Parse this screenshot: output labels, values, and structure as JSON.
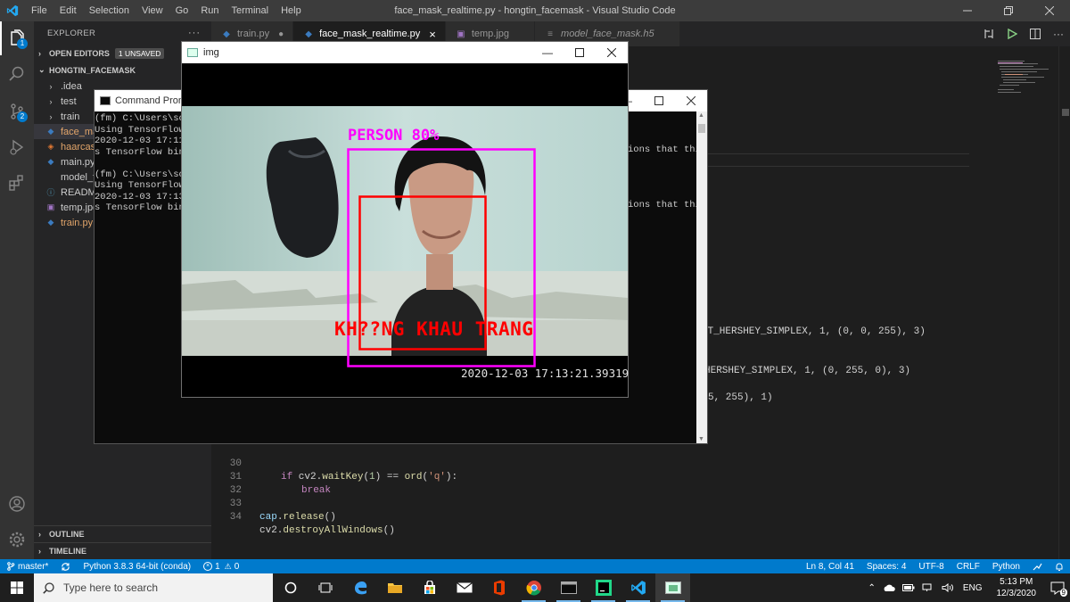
{
  "vscode": {
    "menu": [
      "File",
      "Edit",
      "Selection",
      "View",
      "Go",
      "Run",
      "Terminal",
      "Help"
    ],
    "title": "face_mask_realtime.py - hongtin_facemask - Visual Studio Code",
    "explorer_label": "EXPLORER",
    "open_editors_label": "OPEN EDITORS",
    "unsaved_badge": "1 UNSAVED",
    "project_label": "HONGTIN_FACEMASK",
    "tree": [
      {
        "name": ".idea",
        "kind": "folder",
        "color": "#cccccc"
      },
      {
        "name": "test",
        "kind": "folder",
        "color": "#cccccc"
      },
      {
        "name": "train",
        "kind": "folder",
        "color": "#cccccc"
      },
      {
        "name": "face_mask_realtime.py",
        "kind": "file",
        "color": "#e2a56a"
      },
      {
        "name": "haarcascade_frontalface_default.xml",
        "kind": "file",
        "color": "#e2a56a"
      },
      {
        "name": "main.py",
        "kind": "file",
        "color": "#cccccc"
      },
      {
        "name": "model_face_mask.h5",
        "kind": "file",
        "color": "#cccccc"
      },
      {
        "name": "README.md",
        "kind": "file",
        "color": "#cccccc"
      },
      {
        "name": "temp.jpg",
        "kind": "file",
        "color": "#cccccc"
      },
      {
        "name": "train.py",
        "kind": "file",
        "color": "#e2a56a"
      }
    ],
    "outline_label": "OUTLINE",
    "timeline_label": "TIMELINE",
    "tabs": [
      {
        "label": "train.py",
        "modified": true,
        "active": false,
        "italic": false
      },
      {
        "label": "face_mask_realtime.py",
        "modified": false,
        "active": true,
        "italic": false
      },
      {
        "label": "temp.jpg",
        "modified": false,
        "active": false,
        "italic": false
      },
      {
        "label": "model_face_mask.h5",
        "modified": false,
        "active": false,
        "italic": true
      }
    ],
    "activity_badges": {
      "explorer": "1",
      "scm": "2"
    },
    "code_fragments": {
      "line_a": "NT_HERSHEY_SIMPLEX, 1, (0, 0, 255), 3)",
      "line_b": "HERSHEY_SIMPLEX, 1, (0, 255, 0), 3)",
      "line_c": "5, 255), 1)"
    },
    "code_lines": [
      {
        "num": "30",
        "text": "if cv2.waitKey(1) == ord('q'):"
      },
      {
        "num": "31",
        "text": "break"
      },
      {
        "num": "32",
        "text": ""
      },
      {
        "num": "33",
        "text": "cap.release()"
      },
      {
        "num": "34",
        "text": "cv2.destroyAllWindows()"
      }
    ],
    "statusbar": {
      "branch": "master*",
      "python": "Python 3.8.3 64-bit (conda)",
      "errors": "1",
      "warnings": "0",
      "position": "Ln 8, Col 41",
      "spaces": "Spaces: 4",
      "encoding": "UTF-8",
      "eol": "CRLF",
      "language": "Python"
    }
  },
  "cmd": {
    "title": "Command Prompt",
    "lines": [
      "(fm) C:\\Users\\sonn",
      "Using TensorFlow b",
      "2020-12-03 17:11:4",
      "s TensorFlow binar",
      "",
      "(fm) C:\\Users\\sonn",
      "Using TensorFlow b",
      "2020-12-03 17:13:0",
      "s TensorFlow binar"
    ],
    "fragment_1": "ions that thi",
    "fragment_2": "ions that thi"
  },
  "img_window": {
    "title": "img",
    "person_label": "PERSON 80%",
    "mask_label": "KH??NG KHAU TRANG",
    "timestamp": "2020-12-03 17:13:21.39319"
  },
  "taskbar": {
    "search_placeholder": "Type here to search",
    "lang": "ENG",
    "time": "5:13 PM",
    "date": "12/3/2020",
    "notifications": "9"
  },
  "colors": {
    "vscode_blue": "#007acc",
    "person_box": "#ff00ff",
    "face_box": "#ff0000"
  }
}
